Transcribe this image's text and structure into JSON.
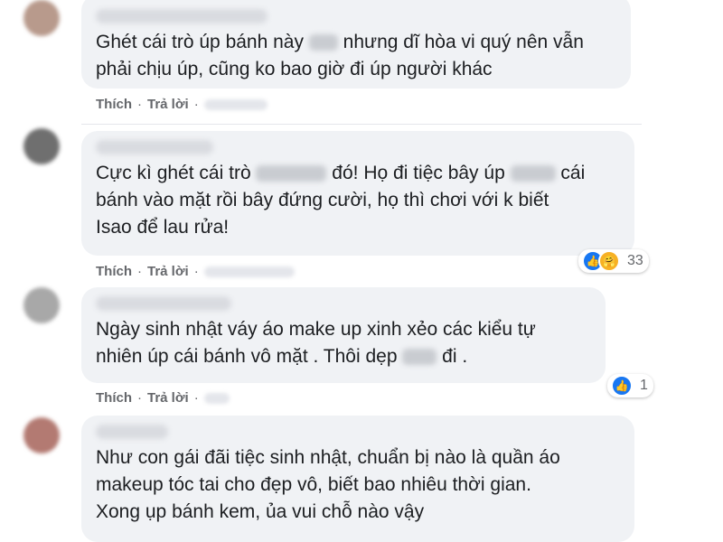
{
  "actions": {
    "like_label": "Thích",
    "reply_label": "Trả lời",
    "separator": "·"
  },
  "comments": [
    {
      "text_parts": [
        "Ghét cái trò úp bánh này ",
        " nhưng dĩ hòa vi quý nên vẫn\nphải chịu úp, cũng ko bao giờ đi úp người khác"
      ]
    },
    {
      "text_parts": [
        "Cực kì ghét cái trò ",
        " đó! Họ đi tiệc bây úp ",
        " cái\nbánh vào mặt rồi bây đứng cười, họ thì chơi với k biết\nIsao để lau rửa!"
      ],
      "reactions": {
        "icons": [
          "like-icon",
          "care-icon"
        ],
        "count": "33"
      }
    },
    {
      "text_parts": [
        "Ngày sinh nhật váy áo make up xinh xẻo các kiểu tự\nnhiên úp cái bánh vô mặt . Thôi dẹp ",
        " đi ."
      ],
      "reactions": {
        "icons": [
          "like-icon"
        ],
        "count": "1"
      }
    },
    {
      "text_parts": [
        "Như con gái đãi tiệc sinh nhật, chuẩn bị nào là quần áo\nmakeup tóc tai cho đẹp vô, biết bao nhiêu thời gian.\nXong ụp bánh kem, ủa vui chỗ nào vậy"
      ]
    }
  ],
  "colors": {
    "bubble_bg": "#f0f2f5",
    "meta_gray": "#65676b",
    "like_blue": "#1877f2",
    "care_yellow": "#f7b125"
  }
}
